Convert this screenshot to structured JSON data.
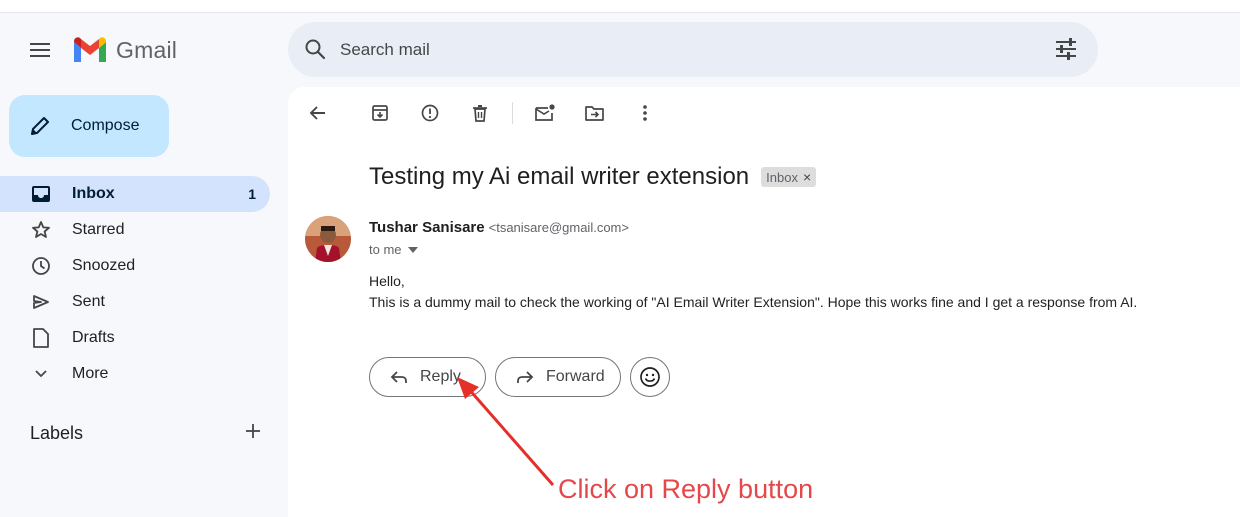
{
  "app": {
    "brand": "Gmail"
  },
  "search": {
    "placeholder": "Search mail"
  },
  "compose": {
    "label": "Compose"
  },
  "sidebar": {
    "items": [
      {
        "label": "Inbox",
        "count": "1",
        "icon": "inbox-icon"
      },
      {
        "label": "Starred",
        "icon": "star-icon"
      },
      {
        "label": "Snoozed",
        "icon": "clock-icon"
      },
      {
        "label": "Sent",
        "icon": "send-icon"
      },
      {
        "label": "Drafts",
        "icon": "draft-icon"
      },
      {
        "label": "More",
        "icon": "chevron-down-icon"
      }
    ],
    "labels_title": "Labels"
  },
  "email": {
    "subject": "Testing my Ai email writer extension",
    "badge": "Inbox",
    "badge_close": "×",
    "sender_name": "Tushar Sanisare",
    "sender_email": "<tsanisare@gmail.com>",
    "recipient": "to me",
    "body_greeting": "Hello,",
    "body_text": "This is a dummy mail to check the working of \"AI Email Writer Extension\". Hope this works fine and I get a response from AI."
  },
  "actions": {
    "reply": "Reply",
    "forward": "Forward"
  },
  "annotation": {
    "text": "Click on Reply button"
  },
  "colors": {
    "compose_bg": "#c2e7ff",
    "active_nav_bg": "#d3e3fd",
    "search_bg": "#e9eef6",
    "annotation": "#e5474b"
  }
}
